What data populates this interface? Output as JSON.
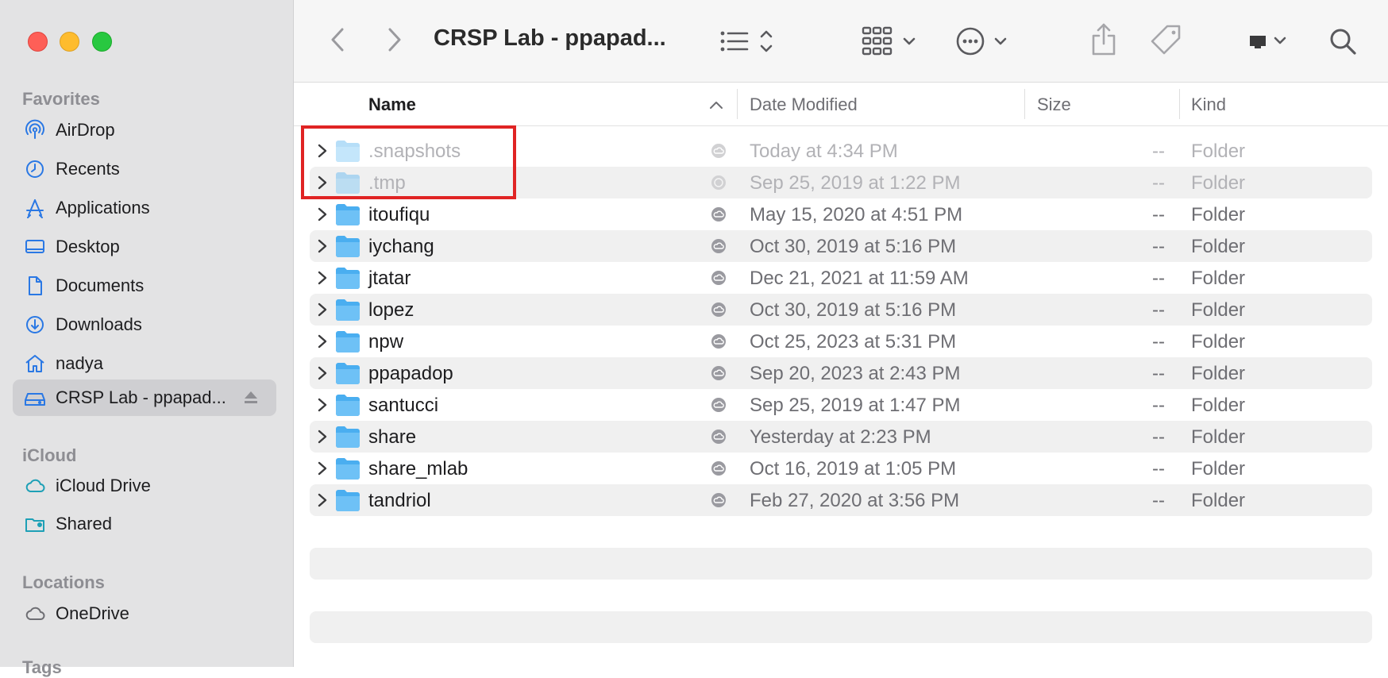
{
  "window": {
    "title": "CRSP Lab - ppapad..."
  },
  "sidebar": {
    "favorites_title": "Favorites",
    "favorites": [
      {
        "label": "AirDrop",
        "icon": "airdrop-icon"
      },
      {
        "label": "Recents",
        "icon": "clock-icon"
      },
      {
        "label": "Applications",
        "icon": "applications-icon"
      },
      {
        "label": "Desktop",
        "icon": "desktop-icon"
      },
      {
        "label": "Documents",
        "icon": "document-icon"
      },
      {
        "label": "Downloads",
        "icon": "download-icon"
      },
      {
        "label": "nadya",
        "icon": "home-icon"
      },
      {
        "label": "CRSP Lab - ppapad...",
        "icon": "network-drive-icon",
        "selected": true
      }
    ],
    "icloud_title": "iCloud",
    "icloud": [
      {
        "label": "iCloud Drive",
        "icon": "cloud-icon"
      },
      {
        "label": "Shared",
        "icon": "shared-folder-icon"
      }
    ],
    "locations_title": "Locations",
    "locations": [
      {
        "label": "OneDrive",
        "icon": "cloud-icon"
      }
    ],
    "tags_title": "Tags"
  },
  "columns": {
    "name": "Name",
    "date_modified": "Date Modified",
    "size": "Size",
    "kind": "Kind"
  },
  "rows": [
    {
      "name": ".snapshots",
      "date": "Today at 4:34 PM",
      "size": "--",
      "kind": "Folder",
      "hidden": true
    },
    {
      "name": ".tmp",
      "date": "Sep 25, 2019 at 1:22 PM",
      "size": "--",
      "kind": "Folder",
      "hidden": true
    },
    {
      "name": "itoufiqu",
      "date": "May 15, 2020 at 4:51 PM",
      "size": "--",
      "kind": "Folder"
    },
    {
      "name": "iychang",
      "date": "Oct 30, 2019 at 5:16 PM",
      "size": "--",
      "kind": "Folder"
    },
    {
      "name": "jtatar",
      "date": "Dec 21, 2021 at 11:59 AM",
      "size": "--",
      "kind": "Folder"
    },
    {
      "name": "lopez",
      "date": "Oct 30, 2019 at 5:16 PM",
      "size": "--",
      "kind": "Folder"
    },
    {
      "name": "npw",
      "date": "Oct 25, 2023 at 5:31 PM",
      "size": "--",
      "kind": "Folder"
    },
    {
      "name": "ppapadop",
      "date": "Sep 20, 2023 at 2:43 PM",
      "size": "--",
      "kind": "Folder"
    },
    {
      "name": "santucci",
      "date": "Sep 25, 2019 at 1:47 PM",
      "size": "--",
      "kind": "Folder"
    },
    {
      "name": "share",
      "date": "Yesterday at 2:23 PM",
      "size": "--",
      "kind": "Folder"
    },
    {
      "name": "share_mlab",
      "date": "Oct 16, 2019 at 1:05 PM",
      "size": "--",
      "kind": "Folder"
    },
    {
      "name": "tandriol",
      "date": "Feb 27, 2020 at 3:56 PM",
      "size": "--",
      "kind": "Folder"
    }
  ],
  "colors": {
    "folder_blue": "#4aaef0",
    "highlight_red": "#e02424",
    "sidebar_bg": "#e3e3e4",
    "accent_blue": "#2a78e4"
  }
}
